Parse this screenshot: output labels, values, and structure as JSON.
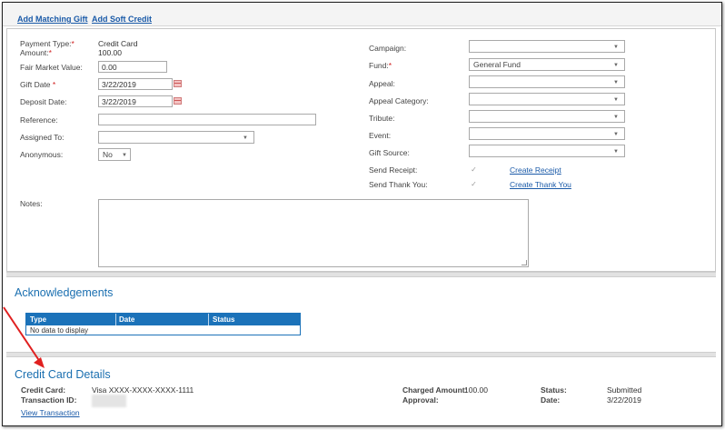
{
  "top_links": {
    "add_matching_gift": "Add Matching Gift",
    "add_soft_credit": "Add Soft Credit"
  },
  "form": {
    "payment_type": {
      "label": "Payment Type:",
      "value": "Credit Card"
    },
    "amount": {
      "label": "Amount:",
      "value": "100.00"
    },
    "fair_market_value": {
      "label": "Fair Market Value:",
      "value": "0.00"
    },
    "gift_date": {
      "label": "Gift Date",
      "value": "3/22/2019"
    },
    "deposit_date": {
      "label": "Deposit Date:",
      "value": "3/22/2019"
    },
    "reference": {
      "label": "Reference:",
      "value": ""
    },
    "assigned_to": {
      "label": "Assigned To:",
      "value": ""
    },
    "anonymous": {
      "label": "Anonymous:",
      "value": "No"
    },
    "notes": {
      "label": "Notes:",
      "value": ""
    },
    "campaign": {
      "label": "Campaign:",
      "value": ""
    },
    "fund": {
      "label": "Fund:",
      "value": "General Fund"
    },
    "appeal": {
      "label": "Appeal:",
      "value": ""
    },
    "appeal_category": {
      "label": "Appeal Category:",
      "value": ""
    },
    "tribute": {
      "label": "Tribute:",
      "value": ""
    },
    "event": {
      "label": "Event:",
      "value": ""
    },
    "gift_source": {
      "label": "Gift Source:",
      "value": ""
    },
    "send_receipt": {
      "label": "Send Receipt:",
      "checked": true,
      "link": "Create Receipt"
    },
    "send_thank_you": {
      "label": "Send Thank You:",
      "checked": true,
      "link": "Create Thank You"
    },
    "required_mark": "*",
    "checkmark": "✓",
    "caret": "▼"
  },
  "acknowledgements": {
    "title": "Acknowledgements",
    "columns": [
      "Type",
      "Date",
      "Status"
    ],
    "empty_text": "No data to display"
  },
  "credit_card_details": {
    "title": "Credit Card Details",
    "credit_card": {
      "label": "Credit Card:",
      "value": "Visa XXXX-XXXX-XXXX-1111"
    },
    "transaction_id": {
      "label": "Transaction ID:",
      "value": ""
    },
    "view_transaction": "View Transaction",
    "charged_amount": {
      "label": "Charged Amount:",
      "value": "100.00"
    },
    "approval": {
      "label": "Approval:",
      "value": ""
    },
    "status": {
      "label": "Status:",
      "value": "Submitted"
    },
    "date": {
      "label": "Date:",
      "value": "3/22/2019"
    }
  },
  "colors": {
    "link": "#1a5aa8",
    "accent": "#1b72b9",
    "required": "#d02020",
    "annotation_arrow": "#e02020"
  }
}
